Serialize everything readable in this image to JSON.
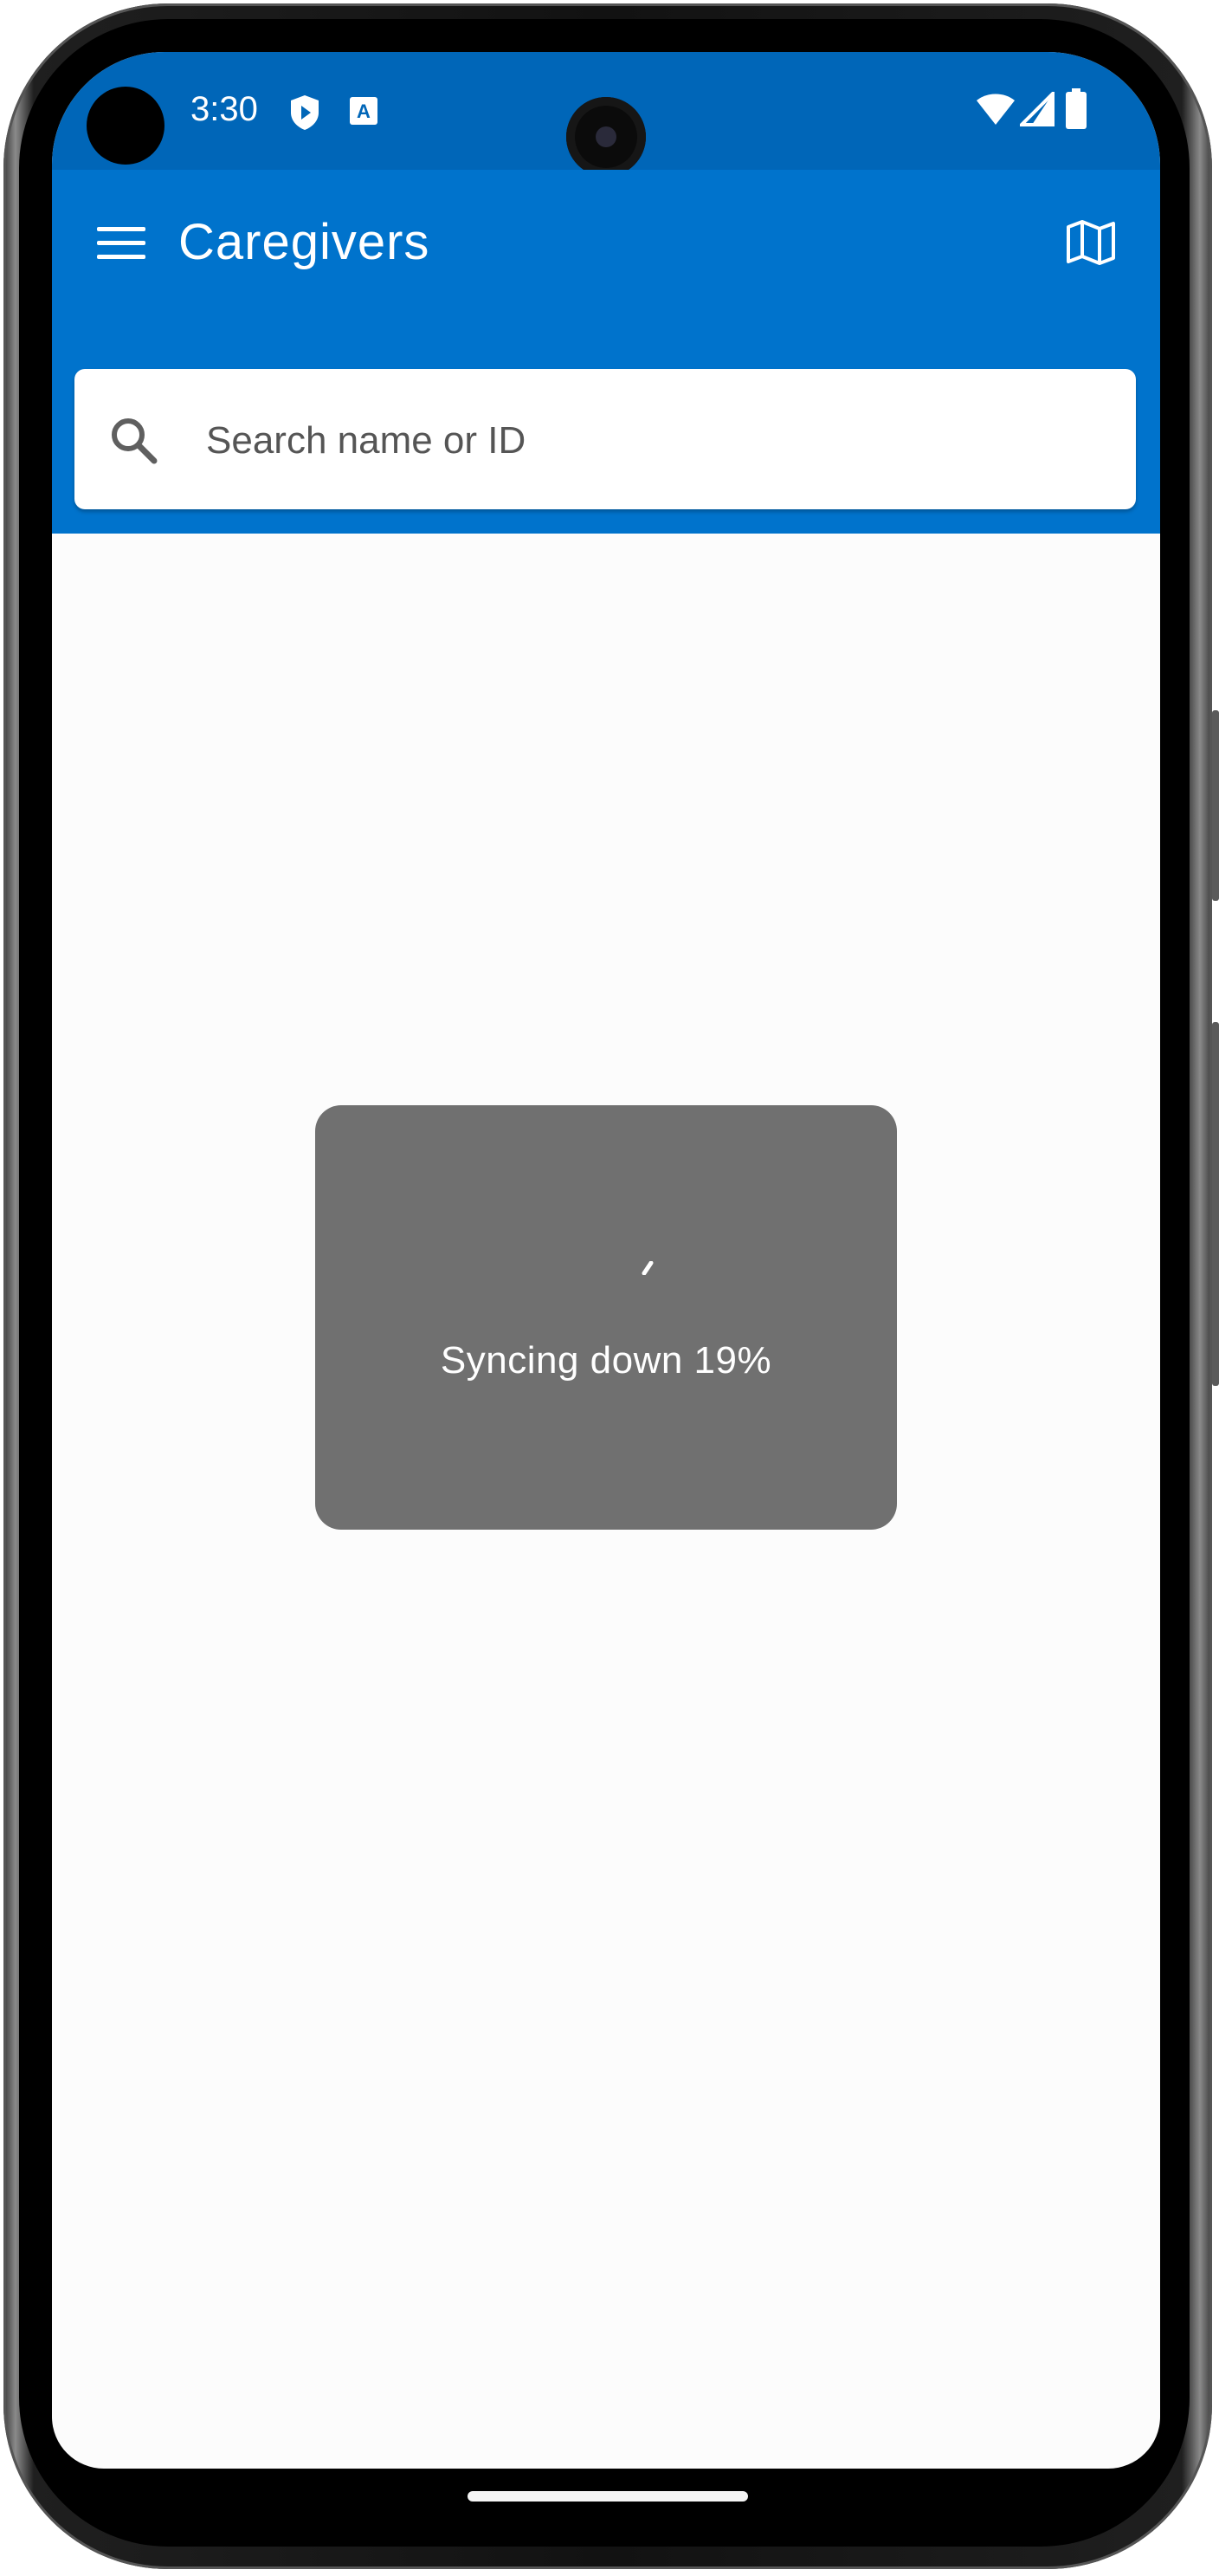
{
  "status_bar": {
    "time": "3:30",
    "icons_left": [
      "shield-play-icon",
      "font-a-icon"
    ],
    "icons_right": [
      "wifi-icon",
      "cellular-signal-icon",
      "battery-icon"
    ]
  },
  "app_bar": {
    "title": "Caregivers",
    "menu_icon": "hamburger-menu-icon",
    "action_icon": "map-icon"
  },
  "search": {
    "placeholder": "Search name or ID",
    "value": ""
  },
  "sync_dialog": {
    "message": "Syncing down 19%",
    "progress_percent": 19
  },
  "colors": {
    "status_bar": "#0066b8",
    "app_bar": "#0073cc",
    "dialog_bg": "#707070",
    "screen_bg": "#fcfcfc"
  }
}
